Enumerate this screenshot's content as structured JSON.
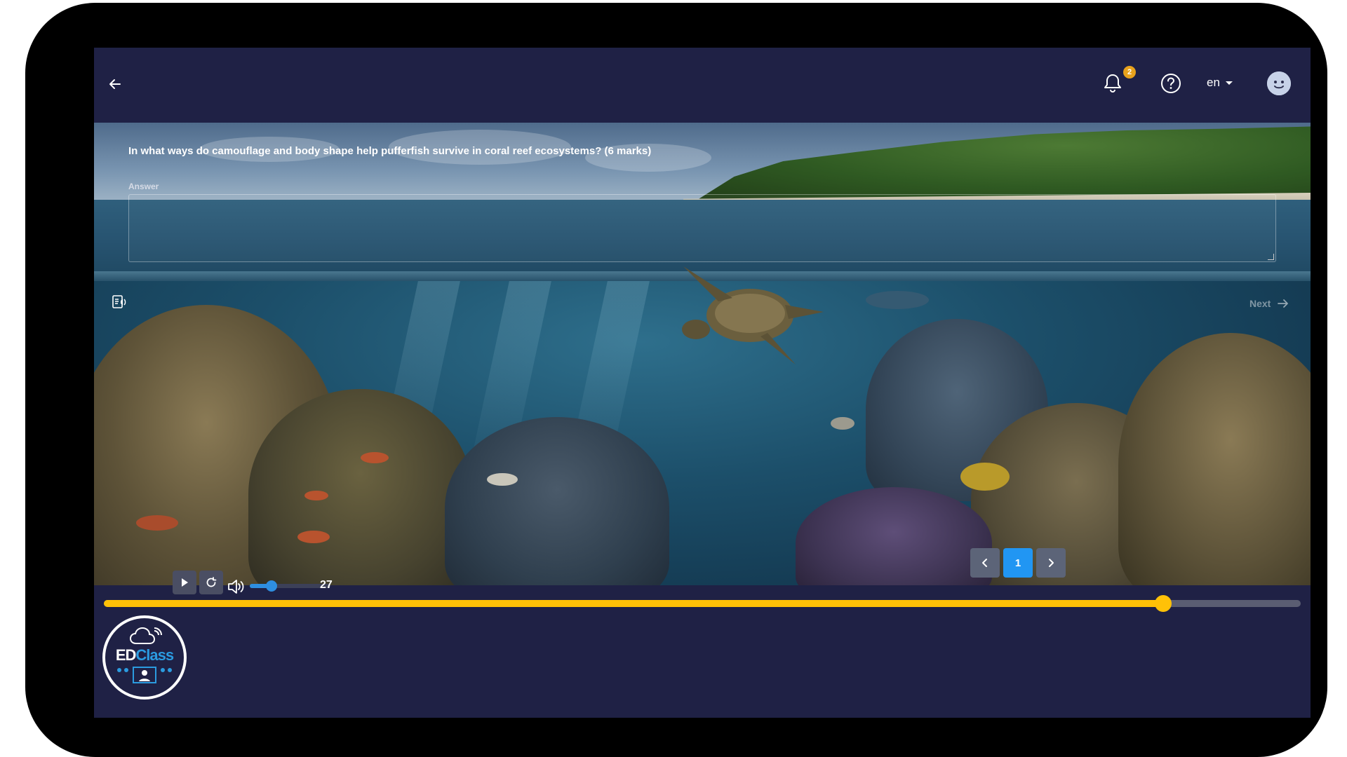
{
  "header": {
    "notification_count": "2",
    "language": "en"
  },
  "question": {
    "text": "In what ways do camouflage and body shape help pufferfish survive in coral reef ecosystems? (6 marks)",
    "answer_label": "Answer",
    "answer_value": ""
  },
  "navigation": {
    "next_label": "Next"
  },
  "player": {
    "progress_fraction": 0.885,
    "volume": 27,
    "volume_label": "27"
  },
  "pagination": {
    "current_page": "1"
  },
  "logo": {
    "text_left": "ED",
    "text_right": "Class"
  },
  "colors": {
    "background": "#1f2145",
    "accent_yellow": "#ffc107",
    "accent_blue": "#2196f3",
    "badge": "#e8a21c"
  },
  "icons": [
    "back-arrow-icon",
    "bell-icon",
    "help-icon",
    "caret-down-icon",
    "avatar-icon",
    "text-to-speech-icon",
    "arrow-right-icon",
    "play-icon",
    "replay-icon",
    "volume-icon",
    "chevron-left-icon",
    "chevron-right-icon"
  ]
}
